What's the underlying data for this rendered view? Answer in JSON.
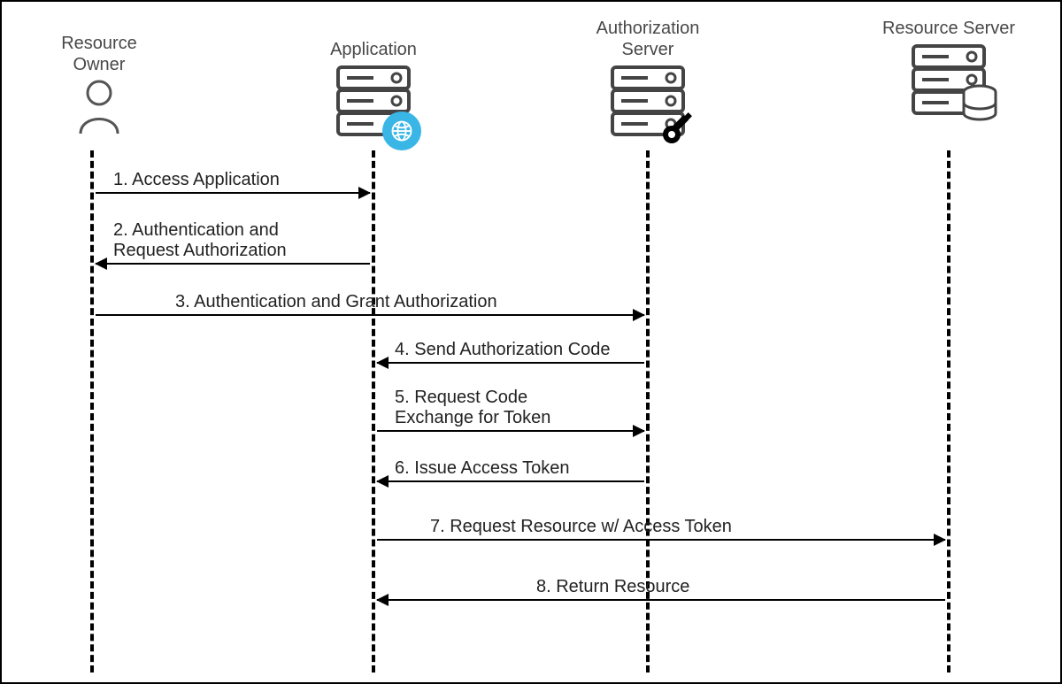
{
  "actors": {
    "owner": {
      "label": "Resource\nOwner"
    },
    "app": {
      "label": "Application"
    },
    "auth": {
      "label": "Authorization\nServer"
    },
    "res": {
      "label": "Resource\nServer"
    }
  },
  "messages": {
    "m1": "1. Access Application",
    "m2": "2. Authentication and\nRequest Authorization",
    "m3": "3. Authentication and Grant Authorization",
    "m4": "4. Send Authorization Code",
    "m5": "5. Request Code\nExchange for Token",
    "m6": "6. Issue Access Token",
    "m7": "7. Request Resource w/ Access Token",
    "m8": "8. Return Resource"
  }
}
